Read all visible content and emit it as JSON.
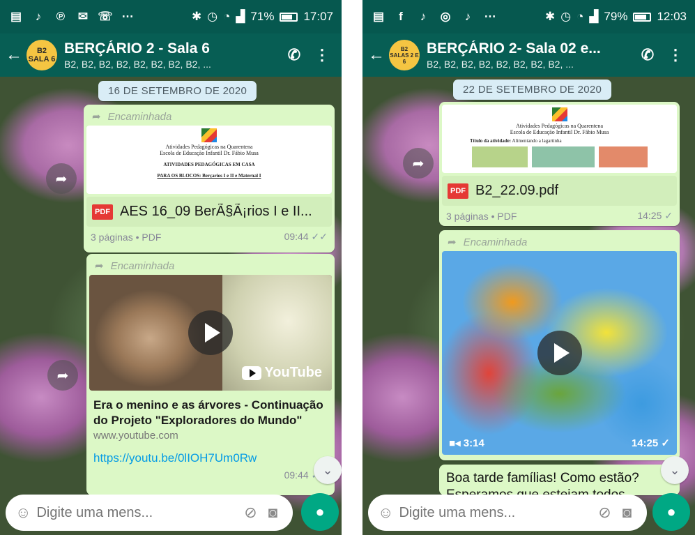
{
  "left": {
    "status": {
      "battery": "71%",
      "battery_level": 0.71,
      "time": "17:07",
      "icons": [
        "notes-icon",
        "tiktok-icon",
        "pinterest-icon",
        "email-icon",
        "missed-call-icon",
        "more-icon",
        "bluetooth-icon",
        "alarm-icon",
        "wifi-icon",
        "signal-icon"
      ]
    },
    "chat": {
      "avatar_line1": "B2",
      "avatar_line2": "SALA 6",
      "title": "BERÇÁRIO 2 - Sala 6",
      "subtitle": "B2, B2, B2, B2, B2, B2, B2, B2, ..."
    },
    "date_chip": "16 DE SETEMBRO DE 2020",
    "doc_message": {
      "forwarded": "Encaminhada",
      "preview_line1": "Atividades Pedagógicas na Quarentena",
      "preview_line2": "Escola de Educação Infantil Dr. Fábio Musa",
      "preview_line3": "ATIVIDADES PEDAGÓGICAS EM CASA",
      "preview_line4": "PARA OS BLOCOS: Berçarios I e II e Maternal I",
      "pdf_label": "PDF",
      "file_name": "AES 16_09 BerÃ§Ã¡rios I e II...",
      "meta": "3 páginas • PDF",
      "time": "09:44"
    },
    "link_message": {
      "forwarded": "Encaminhada",
      "youtube_label": "YouTube",
      "title": "Era o menino e as árvores - Continuação do Projeto \"Exploradores do Mundo\"",
      "domain": "www.youtube.com",
      "url": "https://youtu.be/0lIOH7Um0Rw",
      "time": "09:44"
    },
    "input_placeholder": "Digite uma mens..."
  },
  "right": {
    "status": {
      "battery": "79%",
      "battery_level": 0.79,
      "time": "12:03",
      "icons": [
        "notes-icon",
        "facebook-icon",
        "tiktok-icon",
        "instagram-icon",
        "tiktok-icon",
        "more-icon",
        "bluetooth-icon",
        "alarm-icon",
        "wifi-icon",
        "signal-icon"
      ]
    },
    "chat": {
      "avatar_line1": "B2",
      "avatar_line2": "SALAS 2 E 6",
      "title": "BERÇÁRIO 2- Sala 02 e...",
      "subtitle": "B2, B2, B2, B2, B2, B2, B2, B2, ..."
    },
    "date_chip": "22 DE SETEMBRO DE 2020",
    "doc_message": {
      "preview_line1": "Atividades Pedagógicas na Quarentena",
      "preview_line2": "Escola de Educação Infantil Dr. Fábio Musa",
      "preview_line3": "Título da atividade:",
      "preview_line3b": "Alimentando a lagartinha",
      "pdf_label": "PDF",
      "file_name": "B2_22.09.pdf",
      "meta": "3 páginas • PDF",
      "time": "14:25"
    },
    "video_message": {
      "forwarded": "Encaminhada",
      "duration": "3:14",
      "time": "14:25"
    },
    "text_message": {
      "line1": "Boa tarde famílias! Como estão?",
      "line2": "Esperamos que estejam todos"
    },
    "input_placeholder": "Digite uma mens..."
  },
  "colors": {
    "header": "#075e54",
    "statusbar": "#06584f",
    "bubble": "#dcf8c6",
    "accent": "#00a884",
    "link": "#039be5"
  }
}
